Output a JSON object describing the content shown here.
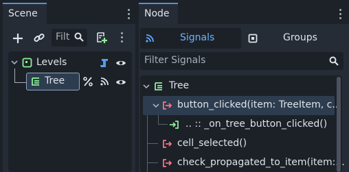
{
  "scene_panel": {
    "tab_label": "Scene",
    "filter_placeholder": "Filt",
    "nodes": [
      {
        "name": "Levels"
      },
      {
        "name": "Tree"
      }
    ]
  },
  "node_panel": {
    "tab_label": "Node",
    "signals_tab": "Signals",
    "groups_tab": "Groups",
    "filter_placeholder": "Filter Signals",
    "root_label": "Tree",
    "signals": [
      "button_clicked(item: TreeItem, c...",
      ".. :: _on_tree_button_clicked()",
      "cell_selected()",
      "check_propagated_to_item(item:..."
    ]
  },
  "colors": {
    "accent": "#4f95dd",
    "node_green": "#8eef97",
    "signal_red": "#ff7085",
    "connection_green": "#8eef97"
  }
}
